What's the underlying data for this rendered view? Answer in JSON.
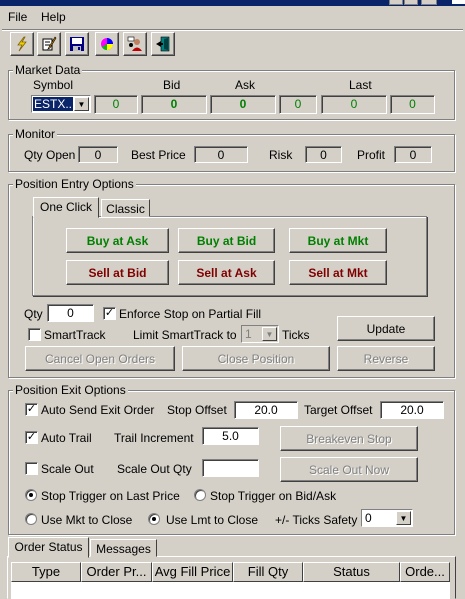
{
  "menu": {
    "file": "File",
    "help": "Help"
  },
  "toolbar": {
    "icons": [
      "lightning-icon",
      "edit-icon",
      "save-icon",
      "chart-icon",
      "users-icon",
      "exit-icon"
    ]
  },
  "market_data": {
    "title": "Market Data",
    "symbol_label": "Symbol",
    "bid_label": "Bid",
    "ask_label": "Ask",
    "last_label": "Last",
    "symbol_value": "ESTX...",
    "bid_size": "0",
    "bid": "0",
    "ask": "0",
    "ask_size": "0",
    "last": "0",
    "last_size": "0"
  },
  "monitor": {
    "title": "Monitor",
    "qty_open_label": "Qty Open",
    "qty_open": "0",
    "best_price_label": "Best Price",
    "best_price": "0",
    "risk_label": "Risk",
    "risk": "0",
    "profit_label": "Profit",
    "profit": "0"
  },
  "entry": {
    "title": "Position Entry Options",
    "tabs": [
      "One Click",
      "Classic"
    ],
    "buy_ask": "Buy at Ask",
    "buy_bid": "Buy at Bid",
    "buy_mkt": "Buy at Mkt",
    "sell_bid": "Sell at Bid",
    "sell_ask": "Sell at Ask",
    "sell_mkt": "Sell at Mkt",
    "qty_label": "Qty",
    "qty_value": "0",
    "enforce_stop": "Enforce Stop on Partial Fill",
    "smarttrack": "SmartTrack",
    "limit_label": "Limit SmartTrack to",
    "limit_value": "1",
    "ticks_label": "Ticks",
    "update": "Update",
    "cancel_orders": "Cancel Open Orders",
    "close_position": "Close Position",
    "reverse": "Reverse"
  },
  "exit": {
    "title": "Position Exit Options",
    "auto_send": "Auto Send Exit Order",
    "stop_offset_label": "Stop Offset",
    "stop_offset": "20.0",
    "target_offset_label": "Target Offset",
    "target_offset": "20.0",
    "auto_trail": "Auto Trail",
    "trail_inc_label": "Trail Increment",
    "trail_inc": "5.0",
    "breakeven": "Breakeven Stop",
    "scale_out": "Scale Out",
    "scale_out_qty_label": "Scale Out Qty",
    "scale_out_qty": "",
    "scale_out_now": "Scale Out Now",
    "trigger_last": "Stop Trigger on Last Price",
    "trigger_bidask": "Stop Trigger on Bid/Ask",
    "use_mkt": "Use Mkt to Close",
    "use_lmt": "Use Lmt to Close",
    "ticks_safety_label": "+/- Ticks Safety",
    "ticks_safety": "0"
  },
  "bottom": {
    "tabs": [
      "Order Status",
      "Messages"
    ],
    "columns": [
      "Type",
      "Order Pr...",
      "Avg Fill Price",
      "Fill Qty",
      "Status",
      "Orde..."
    ]
  }
}
